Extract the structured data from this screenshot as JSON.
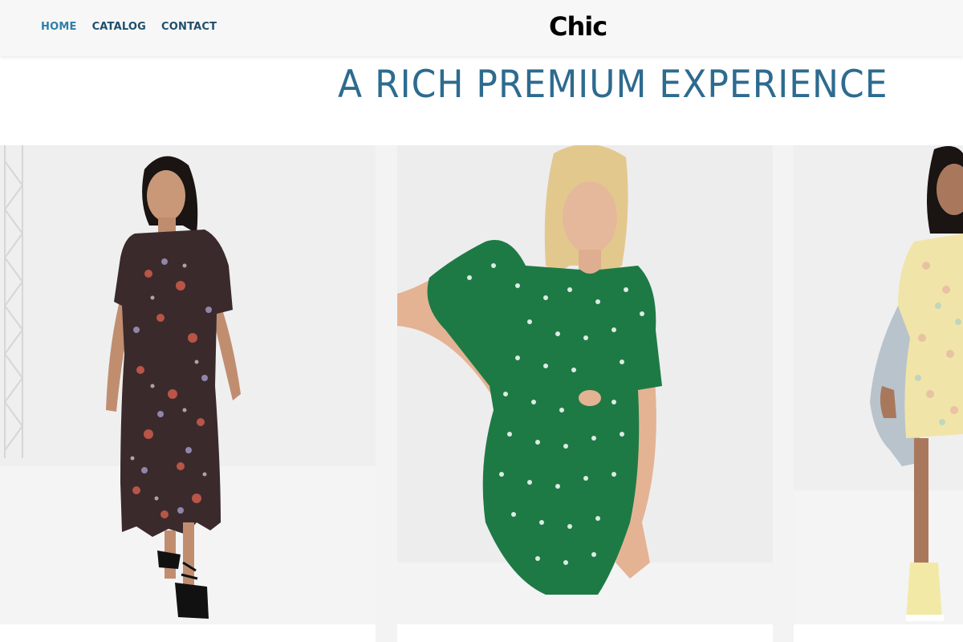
{
  "nav": {
    "home": "HOME",
    "catalog": "CATALOG",
    "contact": "CONTACT"
  },
  "brand": {
    "logo": "Chic"
  },
  "hero": {
    "headline": "A RICH PREMIUM EXPERIENCE"
  },
  "colors": {
    "nav_text": "#1f4e6b",
    "nav_active": "#2d7fa8",
    "headline": "#2d6b8f",
    "header_bg": "#f7f7f7"
  },
  "products": [
    {
      "image": "model-black-floral-midi-dress"
    },
    {
      "image": "model-green-ditsy-cutout-dress"
    },
    {
      "image": "model-yellow-floral-mini-dress"
    }
  ]
}
